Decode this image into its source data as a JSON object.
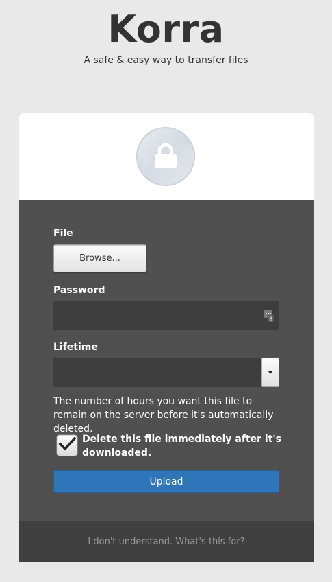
{
  "brand": {
    "title": "Korra",
    "subtitle": "A safe & easy way to transfer files"
  },
  "card": {
    "header_icon": "lock-icon"
  },
  "form": {
    "file_label": "File",
    "browse_label": "Browse...",
    "password_label": "Password",
    "password_value": "",
    "password_field_icon": "password-manager-icon",
    "lifetime_label": "Lifetime",
    "lifetime_value": "",
    "lifetime_help": "The number of hours you want this file to remain on the server before it's automatically deleted.",
    "delete_after_download_label": "Delete this file immediately after it's downloaded.",
    "delete_after_download_checked": true,
    "upload_label": "Upload"
  },
  "footer": {
    "help_link": "I don't understand. What's this for?"
  },
  "colors": {
    "page_bg": "#e9e9e9",
    "panel_bg": "#505050",
    "input_bg": "#3d3d3d",
    "footer_bg": "#404040",
    "primary_button": "#2f76b9"
  }
}
